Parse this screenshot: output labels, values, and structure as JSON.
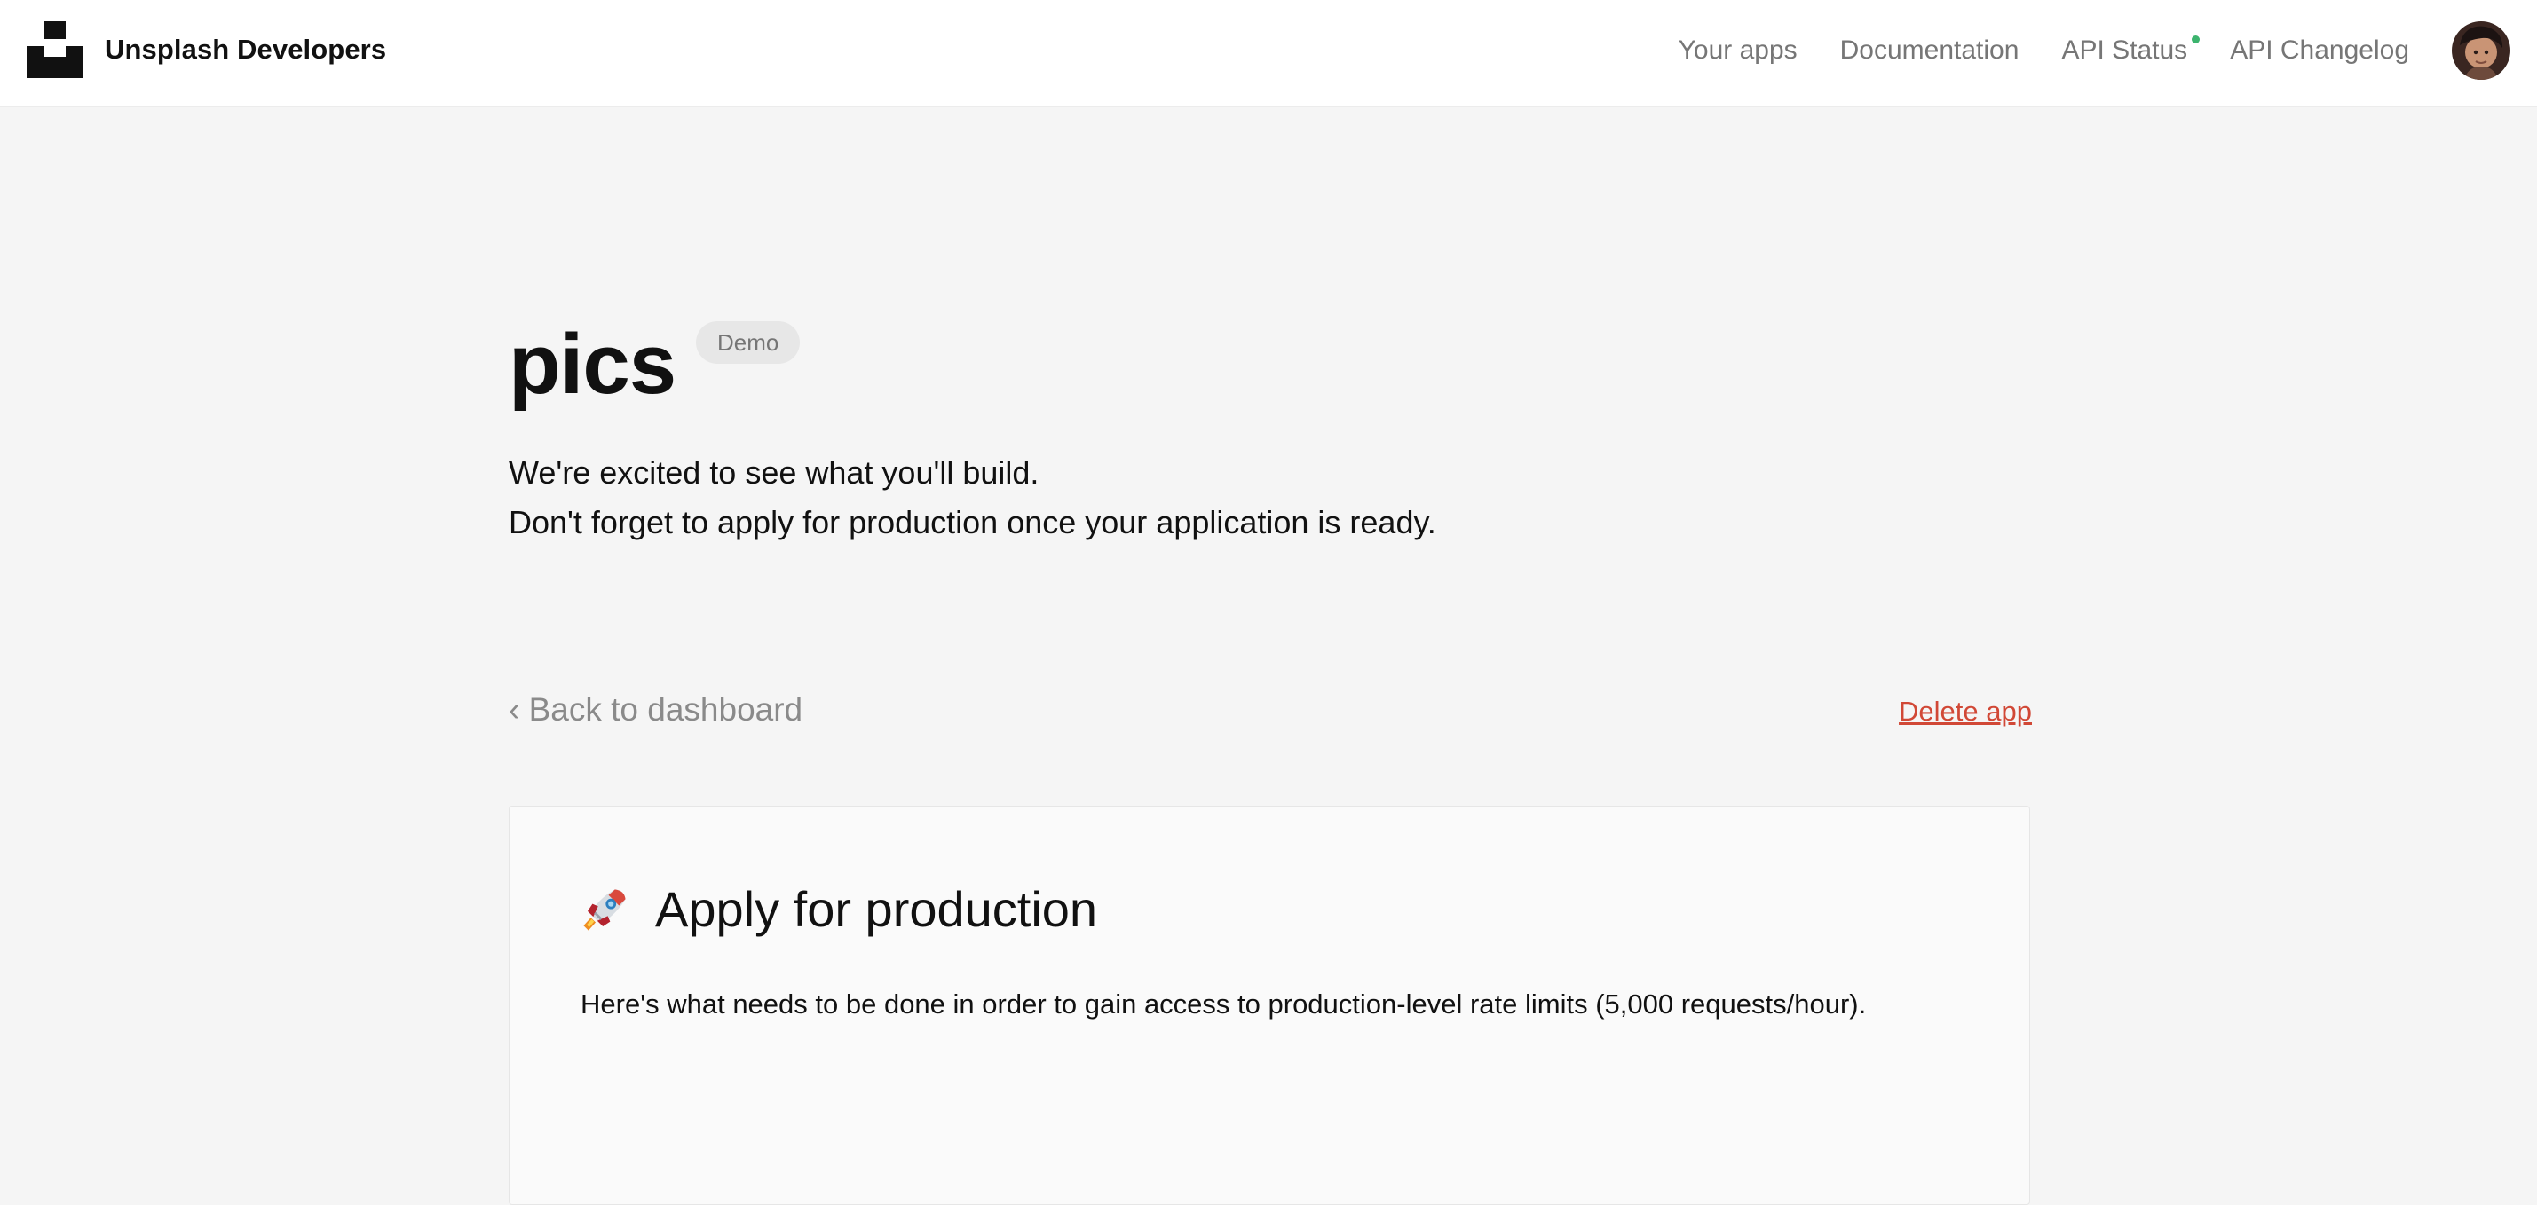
{
  "colors": {
    "header_background": "#ffffff",
    "page_background": "#f5f5f5",
    "nav_text": "#767676",
    "status_dot": "#3cb46e",
    "delete_link": "#d14836",
    "badge_background": "#e7e7e7"
  },
  "header": {
    "brand": "Unsplash Developers",
    "logo_icon": "unsplash-logo-icon",
    "nav": [
      {
        "label": "Your apps"
      },
      {
        "label": "Documentation"
      },
      {
        "label": "API Status"
      },
      {
        "label": "API Changelog"
      }
    ],
    "avatar_icon": "user-avatar-icon"
  },
  "app": {
    "name": "pics",
    "badge": "Demo",
    "intro_line_1": "We're excited to see what you'll build.",
    "intro_line_2": "Don't forget to apply for production once your application is ready."
  },
  "actions": {
    "back": "‹ Back to dashboard",
    "delete": "Delete app"
  },
  "production_card": {
    "icon": "rocket-icon",
    "title": "Apply for production",
    "description": "Here's what needs to be done in order to gain access to production-level rate limits (5,000 requests/hour)."
  }
}
